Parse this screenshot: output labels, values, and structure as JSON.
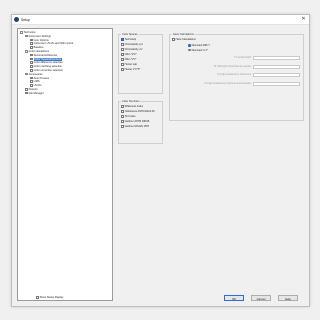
{
  "window": {
    "title": "Setup"
  },
  "tree": {
    "items": [
      {
        "label": "Technotop",
        "indent": 0,
        "glyph": "expanded",
        "selected": false
      },
      {
        "label": "Instrument Settings",
        "indent": 1,
        "glyph": "expanded",
        "selected": false
      },
      {
        "label": "Com Options",
        "indent": 2,
        "glyph": "leaf",
        "selected": false
      },
      {
        "label": "Instrument UV-Vis and NIR control",
        "indent": 2,
        "glyph": "leaf",
        "selected": false
      },
      {
        "label": "Baseline",
        "indent": 2,
        "glyph": "leaf",
        "selected": false
      },
      {
        "label": "Color calculations",
        "indent": 1,
        "glyph": "expanded",
        "selected": false
      },
      {
        "label": "Illuminants/Observer",
        "indent": 2,
        "glyph": "leaf",
        "selected": false
      },
      {
        "label": "Color Spaces/Numbers",
        "indent": 2,
        "glyph": "leaf",
        "selected": true
      },
      {
        "label": "Color difference selection",
        "indent": 2,
        "glyph": "leaf",
        "selected": false
      },
      {
        "label": "Color matching selection",
        "indent": 2,
        "glyph": "leaf",
        "selected": false
      },
      {
        "label": "Color correction selection",
        "indent": 2,
        "glyph": "leaf",
        "selected": false
      },
      {
        "label": "Accessories",
        "indent": 1,
        "glyph": "expanded",
        "selected": false
      },
      {
        "label": "Auto Prosess",
        "indent": 2,
        "glyph": "leaf",
        "selected": false
      },
      {
        "label": "LIMS",
        "indent": 2,
        "glyph": "leaf",
        "selected": false
      },
      {
        "label": "UV/Vis",
        "indent": 2,
        "glyph": "leaf",
        "selected": false
      },
      {
        "label": "Reports",
        "indent": 1,
        "glyph": "leaf",
        "selected": false
      },
      {
        "label": "File Manager",
        "indent": 1,
        "glyph": "leaf",
        "selected": false
      }
    ]
  },
  "color_spaces": {
    "title": "Color Spaces",
    "options": [
      {
        "label": "Technotop",
        "checked": true
      },
      {
        "label": "Chromaticity xyz",
        "checked": false
      },
      {
        "label": "Chromaticity u'v'",
        "checked": false
      },
      {
        "label": "CIE L*a*b*",
        "checked": false
      },
      {
        "label": "CIE L*u*v*",
        "checked": false
      },
      {
        "label": "Hunter Lab",
        "checked": false
      },
      {
        "label": "Hunter L*C*h*",
        "checked": false
      }
    ]
  },
  "color_numbers": {
    "title": "Color Numbers",
    "options": [
      {
        "label": "Whiteness Index",
        "checked": false
      },
      {
        "label": "Yellowness ASTM E313-00",
        "checked": false
      },
      {
        "label": "Tint Index",
        "checked": false
      },
      {
        "label": "Gardner ASTM D6166",
        "checked": false
      },
      {
        "label": "Gardner DIN EN 1557",
        "checked": false
      }
    ]
  },
  "haze": {
    "title": "Haze Calculations",
    "main_option": {
      "label": "Haze Calculations",
      "checked": false
    },
    "illuminants": [
      {
        "label": "Illuminant D65 Y",
        "selected": true
      },
      {
        "label": "Illuminant C 2°",
        "selected": false
      }
    ],
    "fields": [
      {
        "label": "T1 Incident light",
        "value": ""
      },
      {
        "label": "T2 Total light transmitted by sample",
        "value": ""
      },
      {
        "label": "T3 Light scattered by instrument",
        "value": ""
      },
      {
        "label": "T4 Light scattered by instrument and sample",
        "value": ""
      }
    ]
  },
  "footer": {
    "show_status_label": "Show Status Display",
    "ok_label": "OK",
    "cancel_label": "Cancel",
    "help_label": "Help"
  },
  "colors": {
    "accent": "#3a78d8",
    "app_icon": "#1d3f7a"
  }
}
